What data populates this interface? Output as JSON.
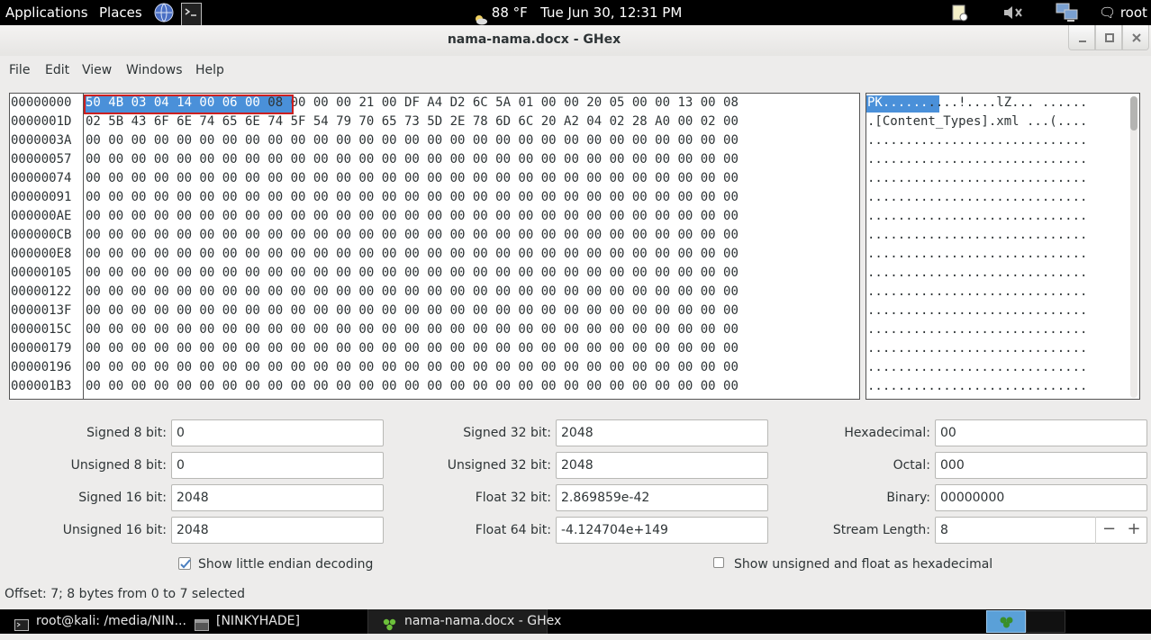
{
  "top_panel": {
    "applications": "Applications",
    "places": "Places",
    "weather": "88 °F",
    "clock": "Tue Jun 30, 12:31 PM",
    "user": "root"
  },
  "window": {
    "title": "nama-nama.docx - GHex"
  },
  "menu": [
    "File",
    "Edit",
    "View",
    "Windows",
    "Help"
  ],
  "hex": {
    "offsets": [
      "00000000",
      "0000001D",
      "0000003A",
      "00000057",
      "00000074",
      "00000091",
      "000000AE",
      "000000CB",
      "000000E8",
      "00000105",
      "00000122",
      "0000013F",
      "0000015C",
      "00000179",
      "00000196",
      "000001B3"
    ],
    "row0_selected": "50 4B 03 04 14 00 06 00",
    "row0_rest": " 08 00 00 00 21 00 DF A4 D2 6C 5A 01 00 00 20 05 00 00 13 00 08",
    "row1": "02 5B 43 6F 6E 74 65 6E 74 5F 54 79 70 65 73 5D 2E 78 6D 6C 20 A2 04 02 28 A0 00 02 00",
    "zero_row": "00 00 00 00 00 00 00 00 00 00 00 00 00 00 00 00 00 00 00 00 00 00 00 00 00 00 00 00 00",
    "partial_row": "00 00 00 00 00 00 00 00 00 00 00 00 00 00 00 00 00 00 00 00 00 00 00 00 00 00 00 00 00"
  },
  "ascii": {
    "row0_selected": "PK......",
    "row0_rest": "....!....lZ... ......",
    "row1": ".[Content_Types].xml ...(....",
    "dots_row": "............................."
  },
  "data_panel": {
    "signed8_label": "Signed 8 bit:",
    "signed8": "0",
    "unsigned8_label": "Unsigned 8 bit:",
    "unsigned8": "0",
    "signed16_label": "Signed 16 bit:",
    "signed16": "2048",
    "unsigned16_label": "Unsigned 16 bit:",
    "unsigned16": "2048",
    "signed32_label": "Signed 32 bit:",
    "signed32": "2048",
    "unsigned32_label": "Unsigned 32 bit:",
    "unsigned32": "2048",
    "float32_label": "Float 32 bit:",
    "float32": "2.869859e-42",
    "float64_label": "Float 64 bit:",
    "float64": "-4.124704e+149",
    "hex_label": "Hexadecimal:",
    "hex": "00",
    "octal_label": "Octal:",
    "octal": "000",
    "binary_label": "Binary:",
    "binary": "00000000",
    "stream_label": "Stream Length:",
    "stream": "8",
    "stream_minus": "−",
    "stream_plus": "+",
    "little_endian_label": "Show little endian decoding",
    "little_endian_checked": true,
    "unsigned_hex_label": "Show unsigned and float as hexadecimal",
    "unsigned_hex_checked": false
  },
  "status": "Offset: 7; 8 bytes from 0 to 7 selected",
  "taskbar": {
    "task1": "root@kali: /media/NIN...",
    "task2": "[NINKYHADE]",
    "task3": "nama-nama.docx - GHex"
  }
}
